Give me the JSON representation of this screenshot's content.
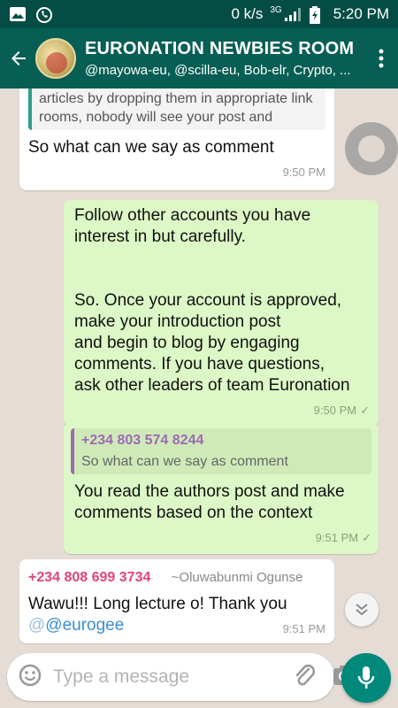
{
  "statusbar": {
    "network_speed": "0 k/s",
    "network_type": "3G",
    "time": "5:20 PM"
  },
  "header": {
    "title": "EURONATION NEWBIES ROOM",
    "subtitle": "@mayowa-eu, @scilla-eu, Bob-elr, Crypto, ..."
  },
  "messages": [
    {
      "quote_text": "Without followers and promoting your articles by dropping them in appropriate link rooms, nobody will see your post and",
      "text": "So what can we say as comment",
      "time": "9:50 PM"
    },
    {
      "text_lines": [
        "Follow other accounts you have",
        "interest in but carefully.",
        "",
        "",
        "So. Once your account is approved,",
        "make your introduction post",
        "and begin to blog by engaging",
        "comments. If you have questions,",
        "ask other leaders of team Euronation"
      ],
      "time": "9:50 PM"
    },
    {
      "quote_name": "+234 803 574 8244",
      "quote_text": "So what can we say as comment",
      "text_lines": [
        "You read the authors post and make",
        "comments based on the context"
      ],
      "time": "9:51 PM"
    },
    {
      "sender": "+234 808 699 3734",
      "alias": "~Oluwabunmi Ogunse",
      "text": "Wawu!!! Long lecture o! Thank you",
      "mention_prefix": "@",
      "mention": "@eurogee",
      "time": "9:51 PM"
    }
  ],
  "composer": {
    "placeholder": "Type a message"
  },
  "colors": {
    "header": "#075e54",
    "statusbar": "#054d44",
    "outgoing_bubble": "#dcf8c6",
    "incoming_bubble": "#ffffff",
    "accent": "#00897b",
    "quote_name": "#9c6bb0",
    "sender_name": "#e0457b"
  },
  "icons": [
    "image-icon",
    "whatsapp-icon",
    "signal-icon",
    "battery-icon",
    "back-arrow-icon",
    "more-vert-icon",
    "emoji-icon",
    "attach-icon",
    "camera-icon",
    "mic-icon",
    "chevron-down-icon"
  ]
}
